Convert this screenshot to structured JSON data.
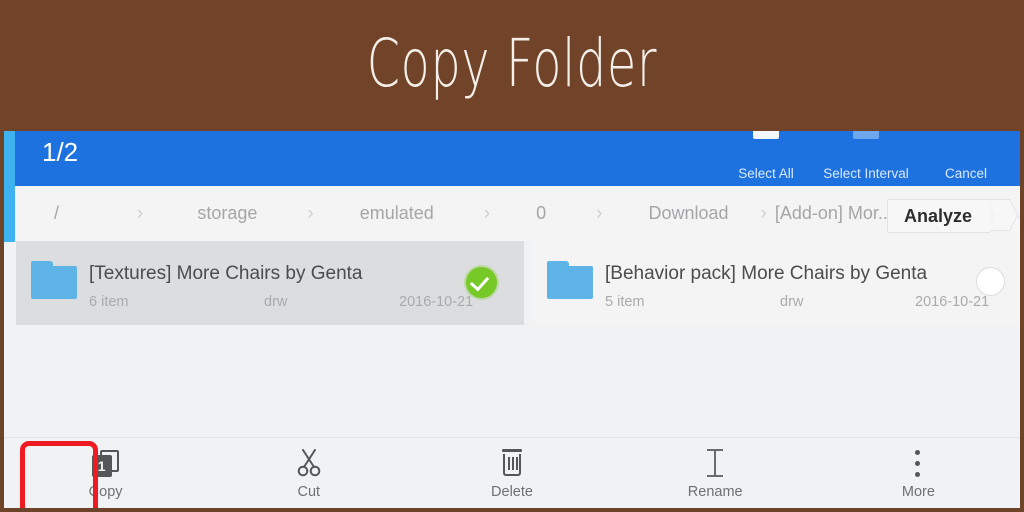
{
  "banner": {
    "title": "Copy Folder",
    "background_color": "#71442a",
    "text_color": "#f4efe9"
  },
  "toolbar": {
    "selection_count": "1/2",
    "background_color": "#1d72e0",
    "actions": [
      {
        "label": "Select All",
        "icon": "select-all-icon"
      },
      {
        "label": "Select Interval",
        "icon": "select-interval-icon"
      },
      {
        "label": "Cancel",
        "icon": "cancel-icon"
      }
    ]
  },
  "breadcrumb": {
    "separator": "›",
    "items": [
      {
        "label": "/"
      },
      {
        "label": "storage"
      },
      {
        "label": "emulated"
      },
      {
        "label": "0"
      },
      {
        "label": "Download"
      },
      {
        "label": "[Add-on] Mor..."
      }
    ],
    "analyze_label": "Analyze"
  },
  "file_list": {
    "rows": [
      {
        "name": "[Textures] More Chairs by Genta",
        "item_count": "6 item",
        "permissions": "drw",
        "date": "2016-10-21",
        "selected": true,
        "icon": "folder-icon"
      },
      {
        "name": "[Behavior pack] More Chairs by Genta",
        "item_count": "5 item",
        "permissions": "drw",
        "date": "2016-10-21",
        "selected": false,
        "icon": "folder-icon"
      }
    ],
    "selected_check_color": "#76c926",
    "folder_color": "#5eb4e7"
  },
  "bottom_bar": {
    "items": [
      {
        "label": "Copy",
        "icon": "copy-icon",
        "badge": "1",
        "highlighted": true
      },
      {
        "label": "Cut",
        "icon": "scissors-icon"
      },
      {
        "label": "Delete",
        "icon": "trash-icon"
      },
      {
        "label": "Rename",
        "icon": "text-cursor-icon"
      },
      {
        "label": "More",
        "icon": "more-vertical-icon"
      }
    ],
    "highlight_color": "#ee1c22"
  }
}
